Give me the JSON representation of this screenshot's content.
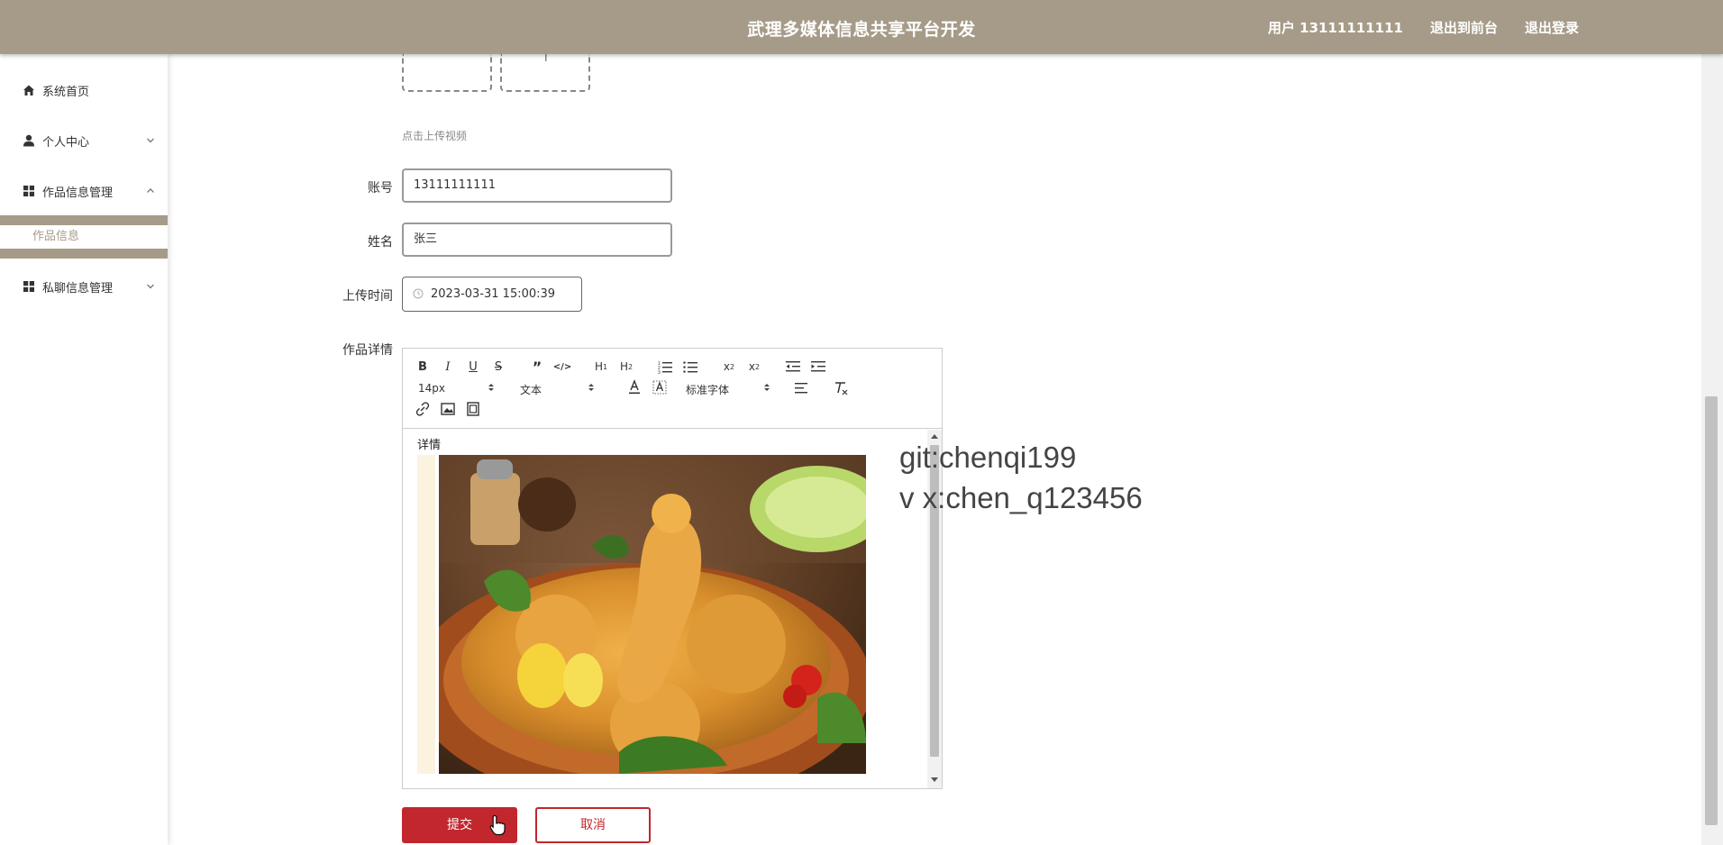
{
  "header": {
    "app_title": "武理多媒体信息共享平台开发",
    "user_label": "用户 13111111111",
    "back_to_front": "退出到前台",
    "logout": "退出登录"
  },
  "sidebar": {
    "items": [
      {
        "label": "系统首页",
        "icon": "home-icon"
      },
      {
        "label": "个人中心",
        "icon": "user-icon"
      },
      {
        "label": "作品信息管理",
        "icon": "grid-icon"
      },
      {
        "label": "私聊信息管理",
        "icon": "grid-icon"
      }
    ],
    "submenu": {
      "label": "作品信息"
    }
  },
  "form": {
    "upload_hint": "点击上传视频",
    "account_label": "账号",
    "account_value": "13111111111",
    "name_label": "姓名",
    "name_value": "张三",
    "upload_time_label": "上传时间",
    "upload_time_value": "2023-03-31 15:00:39",
    "detail_label": "作品详情"
  },
  "editor": {
    "font_size": "14px",
    "text_style": "文本",
    "font_family": "标准字体",
    "content_text": "详情",
    "image_subject": "fried chicken on a plate"
  },
  "watermark": {
    "line1": "git:chenqi199",
    "line2": "v x:chen_q123456"
  },
  "buttons": {
    "submit": "提交",
    "cancel": "取消"
  },
  "colors": {
    "header_bg": "#a69b88",
    "accent": "#c1272d"
  }
}
